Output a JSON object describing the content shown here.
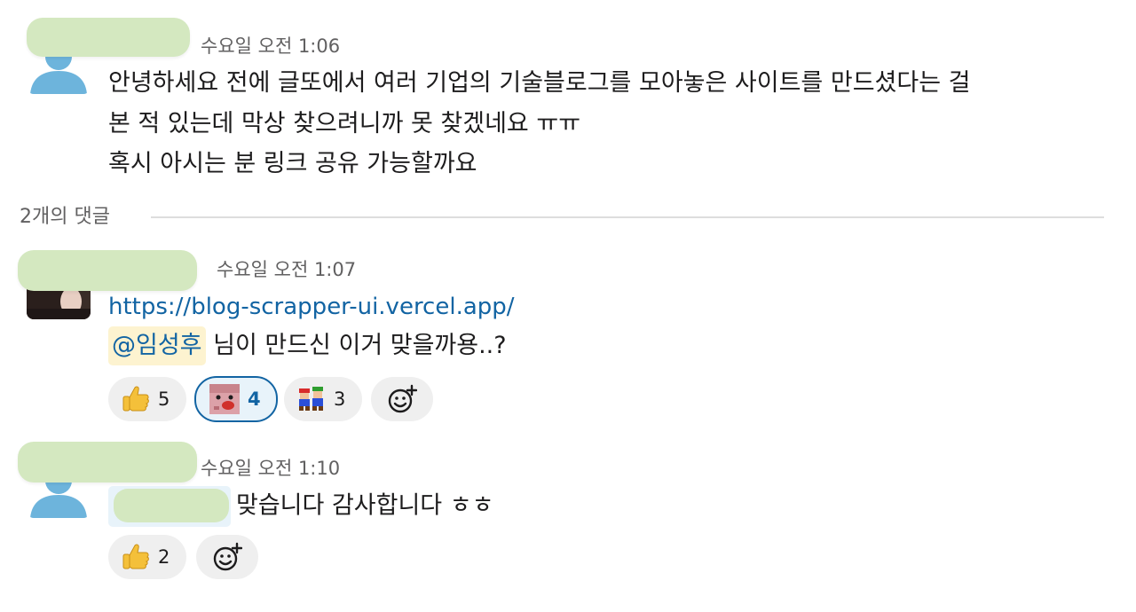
{
  "messages": [
    {
      "time": "수요일 오전 1:06",
      "lines": [
        "안녕하세요 전에 글또에서 여러 기업의 기술블로그를 모아놓은 사이트를 만드셨다는 걸",
        "본 적 있는데 막상 찾으려니까 못 찾겠네요 ㅠㅠ",
        "혹시 아시는 분 링크 공유 가능할까요"
      ]
    }
  ],
  "thread": {
    "reply_count_label": "2개의 댓글"
  },
  "replies": [
    {
      "time": "수요일 오전 1:07",
      "link": "https://blog-scrapper-ui.vercel.app/",
      "mention": "@임성후",
      "text": " 님이 만드신 이거 맞을까용..?",
      "reactions": [
        {
          "emoji": "thumbs-up",
          "count": "5"
        },
        {
          "emoji": "custom-pink-creature",
          "count": "4",
          "active": true
        },
        {
          "emoji": "mario-luigi",
          "count": "3"
        }
      ]
    },
    {
      "time": "수요일 오전 1:10",
      "text": "맞습니다 감사합니다 ㅎㅎ",
      "reactions": [
        {
          "emoji": "thumbs-up",
          "count": "2"
        }
      ]
    }
  ],
  "colors": {
    "link": "#1264a3",
    "name_blur": "#d4e8c0",
    "mention_bg": "#fdf3d0",
    "reaction_bg": "#efefef",
    "reaction_active_border": "#1264a3"
  },
  "icons": {
    "add_reaction": "add-reaction-icon",
    "thumbs_up": "thumbs-up-icon",
    "default_avatar": "default-avatar-icon"
  }
}
